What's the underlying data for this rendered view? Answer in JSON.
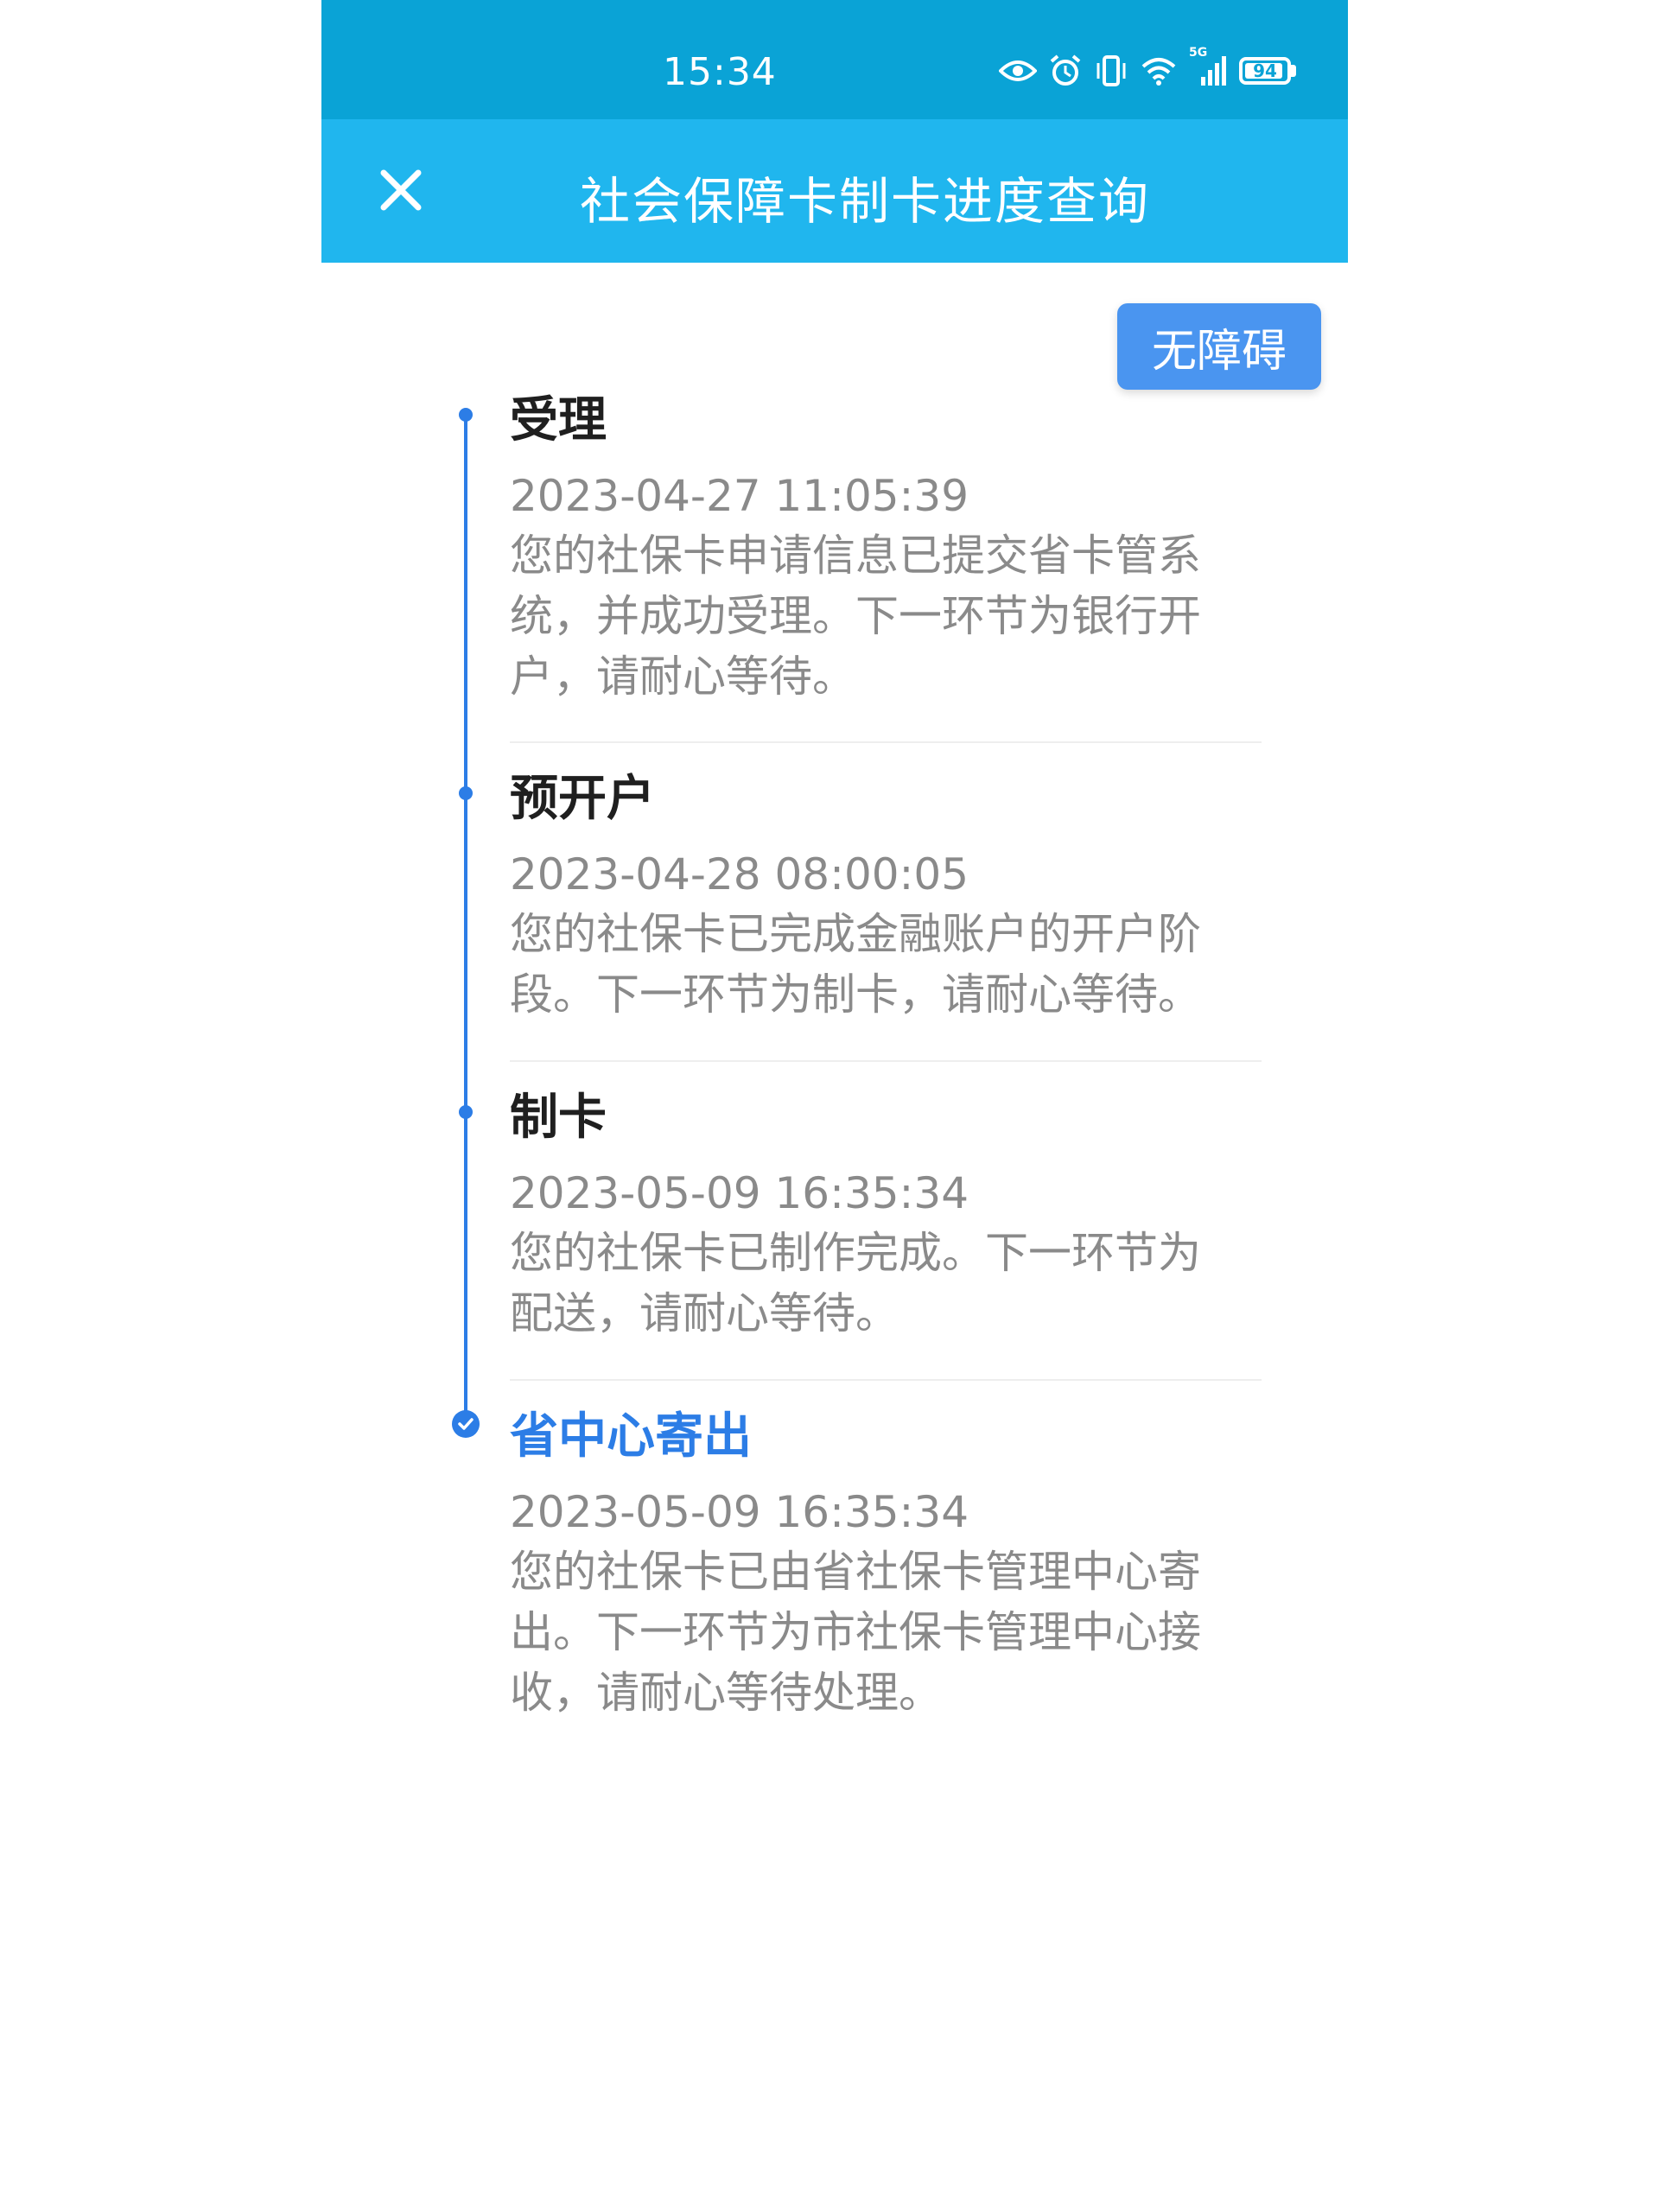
{
  "status_bar": {
    "time": "15:34",
    "network": "5G",
    "battery": "94",
    "battery_level": 0.94,
    "icons": [
      "eye-icon",
      "alarm-icon",
      "vibrate-icon",
      "wifi-icon",
      "signal-icon",
      "battery-icon"
    ]
  },
  "header": {
    "title": "社会保障卡制卡进度查询",
    "close_icon": "close-icon"
  },
  "accessibility_button": "无障碍",
  "colors": {
    "status_bar": "#0aa3d6",
    "header": "#20b6ee",
    "accent": "#2c7de6",
    "button": "#4a95f0"
  },
  "steps": [
    {
      "title": "受理",
      "time": "2023-04-27 11:05:39",
      "desc": [
        "您的社保卡申请信息已提交省卡管系",
        "统，并成功受理。下一环节为银行开",
        "户，请耐心等待。"
      ]
    },
    {
      "title": "预开户",
      "time": "2023-04-28 08:00:05",
      "desc": [
        "您的社保卡已完成金融账户的开户阶",
        "段。下一环节为制卡，请耐心等待。"
      ]
    },
    {
      "title": "制卡",
      "time": "2023-05-09 16:35:34",
      "desc": [
        "您的社保卡已制作完成。下一环节为",
        "配送，请耐心等待。"
      ]
    },
    {
      "title": "省中心寄出",
      "time": "2023-05-09 16:35:34",
      "desc": [
        "您的社保卡已由省社保卡管理中心寄",
        "出。下一环节为市社保卡管理中心接",
        "收，请耐心等待处理。"
      ],
      "current": true
    }
  ]
}
